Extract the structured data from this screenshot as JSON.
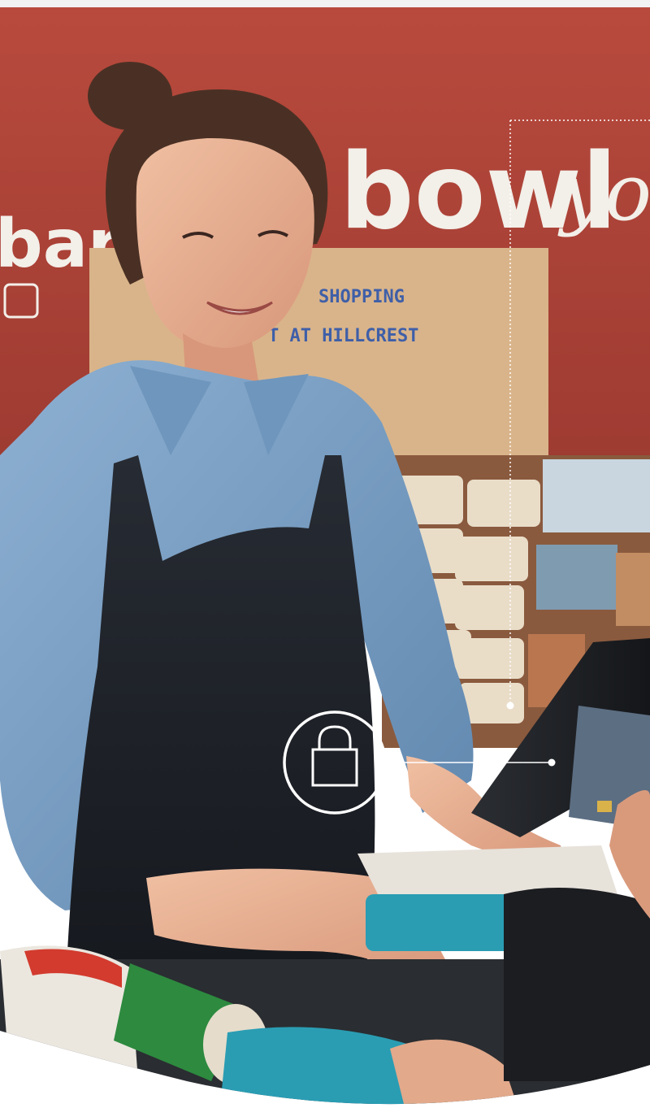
{
  "scene": {
    "wall_sign": {
      "left_word": "barg",
      "main_word": "bowl",
      "script_word": "yo"
    },
    "poster": {
      "line1": "SHOPPING",
      "line2": "T AT HILLCREST"
    }
  },
  "overlay": {
    "icon": "padlock-icon"
  },
  "colors": {
    "wall": "#b5453a",
    "shirt": "#7fa3c6",
    "apron": "#1e2228",
    "overlay_line": "#ffffff"
  }
}
